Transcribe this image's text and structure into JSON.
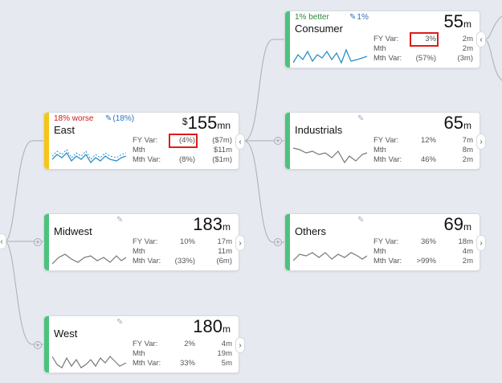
{
  "nodes": {
    "consumer": {
      "name": "Consumer",
      "note": "1% better",
      "var": "1%",
      "currency": "",
      "value": "55",
      "unit": "m",
      "rows": [
        {
          "label": "FY Var:",
          "v1": "3%",
          "v2": "2m"
        },
        {
          "label": "Mth",
          "v1": "",
          "v2": "2m"
        },
        {
          "label": "Mth Var:",
          "v1": "(57%)",
          "v2": "(3m)"
        }
      ]
    },
    "east": {
      "name": "East",
      "note": "18% worse",
      "var": "(18%)",
      "currency": "$",
      "value": "155",
      "unit": "mn",
      "rows": [
        {
          "label": "FY Var:",
          "v1": "(4%)",
          "v2": "($7m)"
        },
        {
          "label": "Mth",
          "v1": "",
          "v2": "$11m"
        },
        {
          "label": "Mth Var:",
          "v1": "(8%)",
          "v2": "($1m)"
        }
      ]
    },
    "industrials": {
      "name": "Industrials",
      "value": "65",
      "unit": "m",
      "rows": [
        {
          "label": "FY Var:",
          "v1": "12%",
          "v2": "7m"
        },
        {
          "label": "Mth",
          "v1": "",
          "v2": "8m"
        },
        {
          "label": "Mth Var:",
          "v1": "46%",
          "v2": "2m"
        }
      ]
    },
    "midwest": {
      "name": "Midwest",
      "value": "183",
      "unit": "m",
      "rows": [
        {
          "label": "FY Var:",
          "v1": "10%",
          "v2": "17m"
        },
        {
          "label": "Mth",
          "v1": "",
          "v2": "11m"
        },
        {
          "label": "Mth Var:",
          "v1": "(33%)",
          "v2": "(6m)"
        }
      ]
    },
    "others": {
      "name": "Others",
      "value": "69",
      "unit": "m",
      "rows": [
        {
          "label": "FY Var:",
          "v1": "36%",
          "v2": "18m"
        },
        {
          "label": "Mth",
          "v1": "",
          "v2": "4m"
        },
        {
          "label": "Mth Var:",
          "v1": ">99%",
          "v2": "2m"
        }
      ]
    },
    "west": {
      "name": "West",
      "value": "180",
      "unit": "m",
      "rows": [
        {
          "label": "FY Var:",
          "v1": "2%",
          "v2": "4m"
        },
        {
          "label": "Mth",
          "v1": "",
          "v2": "19m"
        },
        {
          "label": "Mth Var:",
          "v1": "33%",
          "v2": "5m"
        }
      ]
    }
  },
  "colors": {
    "good": "#4cc27e",
    "warn": "#f5c518",
    "spark_blue": "#2a8fc7",
    "spark_gray": "#777777",
    "highlight": "#e01b1b"
  },
  "icons": {
    "expand": "chevron-right-icon",
    "collapse": "chevron-left-icon",
    "add": "plus-circle-icon",
    "edit": "pencil-icon"
  }
}
